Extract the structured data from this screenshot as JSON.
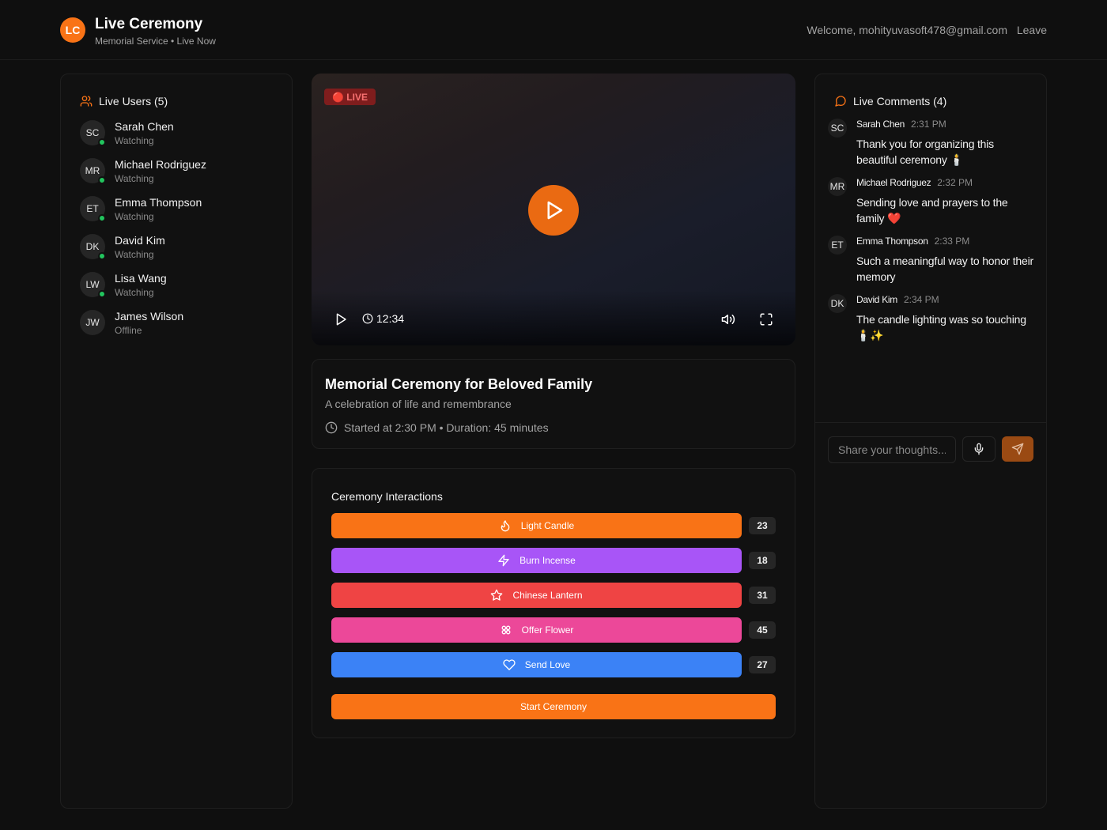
{
  "header": {
    "logo_initials": "LC",
    "title": "Live Ceremony",
    "subtitle": "Memorial Service • Live Now",
    "welcome": "Welcome, mohityuvasoft478@gmail.com",
    "leave_label": "Leave"
  },
  "users": {
    "heading": "Live Users (5)",
    "items": [
      {
        "initials": "SC",
        "name": "Sarah Chen",
        "status": "Watching"
      },
      {
        "initials": "MR",
        "name": "Michael Rodriguez",
        "status": "Watching"
      },
      {
        "initials": "ET",
        "name": "Emma Thompson",
        "status": "Watching"
      },
      {
        "initials": "DK",
        "name": "David Kim",
        "status": "Watching"
      },
      {
        "initials": "LW",
        "name": "Lisa Wang",
        "status": "Watching"
      },
      {
        "initials": "JW",
        "name": "James Wilson",
        "status": "Offline"
      }
    ]
  },
  "video": {
    "live_label": "🔴 LIVE",
    "time": "12:34"
  },
  "info": {
    "title": "Memorial Ceremony for Beloved Family",
    "subtitle": "A celebration of life and remembrance",
    "meta": "Started at 2:30 PM • Duration: 45 minutes"
  },
  "interactions": {
    "heading": "Ceremony Interactions",
    "actions": [
      {
        "label": "Light Candle",
        "count": "23",
        "color": "#f97316",
        "icon": "flame-icon"
      },
      {
        "label": "Burn Incense",
        "count": "18",
        "color": "#a855f7",
        "icon": "zap-icon"
      },
      {
        "label": "Chinese Lantern",
        "count": "31",
        "color": "#ef4444",
        "icon": "star-icon"
      },
      {
        "label": "Offer Flower",
        "count": "45",
        "color": "#ec4899",
        "icon": "flower-icon"
      },
      {
        "label": "Send Love",
        "count": "27",
        "color": "#3b82f6",
        "icon": "heart-icon"
      }
    ],
    "start_label": "Start Ceremony"
  },
  "comments": {
    "heading": "Live Comments (4)",
    "items": [
      {
        "initials": "SC",
        "author": "Sarah Chen",
        "time": "2:31 PM",
        "text": "Thank you for organizing this beautiful ceremony 🕯️"
      },
      {
        "initials": "MR",
        "author": "Michael Rodriguez",
        "time": "2:32 PM",
        "text": "Sending love and prayers to the family ❤️"
      },
      {
        "initials": "ET",
        "author": "Emma Thompson",
        "time": "2:33 PM",
        "text": "Such a meaningful way to honor their memory"
      },
      {
        "initials": "DK",
        "author": "David Kim",
        "time": "2:34 PM",
        "text": "The candle lighting was so touching 🕯️✨"
      }
    ],
    "input_placeholder": "Share your thoughts..."
  }
}
